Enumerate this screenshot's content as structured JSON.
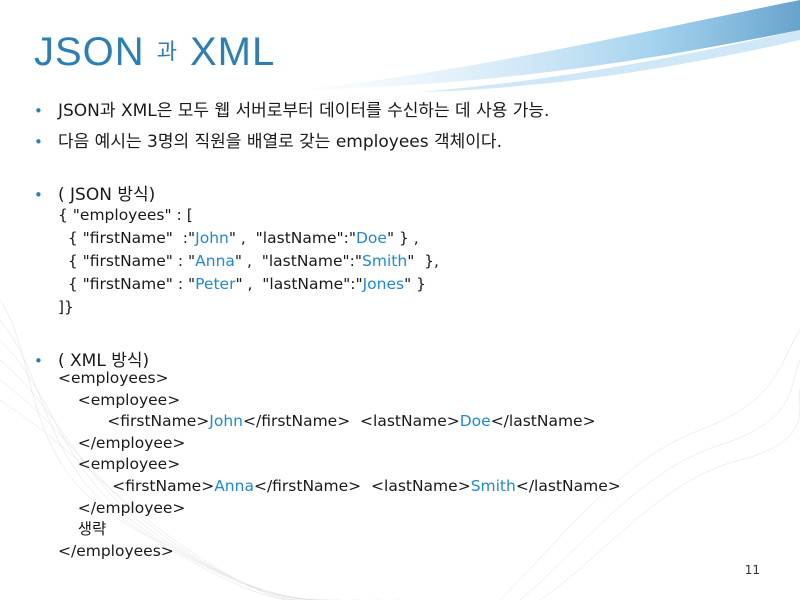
{
  "slide": {
    "title_left": "JSON",
    "title_mid": "과",
    "title_right": "XML",
    "bullets": [
      "JSON과 XML은 모두 웹 서버로부터 데이터를 수신하는 데 사용 가능.",
      "다음 예시는  3명의 직원을 배열로 갖는  employees 객체이다."
    ],
    "json_heading": "( JSON 방식)",
    "json_open": "{ \"employees\" : [",
    "json_rows": [
      {
        "pre": "{ \"firstName\"  :\"",
        "first": "John",
        "mid": "\" ,  \"lastName\":\"",
        "last": "Doe",
        "post": "\" } ,"
      },
      {
        "pre": "{ \"firstName\" : \"",
        "first": "Anna",
        "mid": "\" ,  \"lastName\":\"",
        "last": "Smith",
        "post": "\"  },"
      },
      {
        "pre": "{ \"firstName\" : \"",
        "first": "Peter",
        "mid": "\" ,  \"lastName\":\"",
        "last": "Jones",
        "post": "\" }"
      }
    ],
    "json_close": "]}",
    "xml_heading": "( XML 방식)",
    "xml_open": "<employees>",
    "xml_emp_open": "<employee>",
    "xml_emp_close": "</employee>",
    "xml_rows": [
      {
        "pre": "<firstName>",
        "first": "John",
        "mid": "</firstName>  <lastName>",
        "last": "Doe",
        "post": "</lastName>"
      },
      {
        "pre": "<firstName>",
        "first": "Anna",
        "mid": "</firstName>  <lastName>",
        "last": "Smith",
        "post": "</lastName>"
      }
    ],
    "xml_omit": "생략",
    "xml_close": "</employees>",
    "page_number": "11"
  }
}
